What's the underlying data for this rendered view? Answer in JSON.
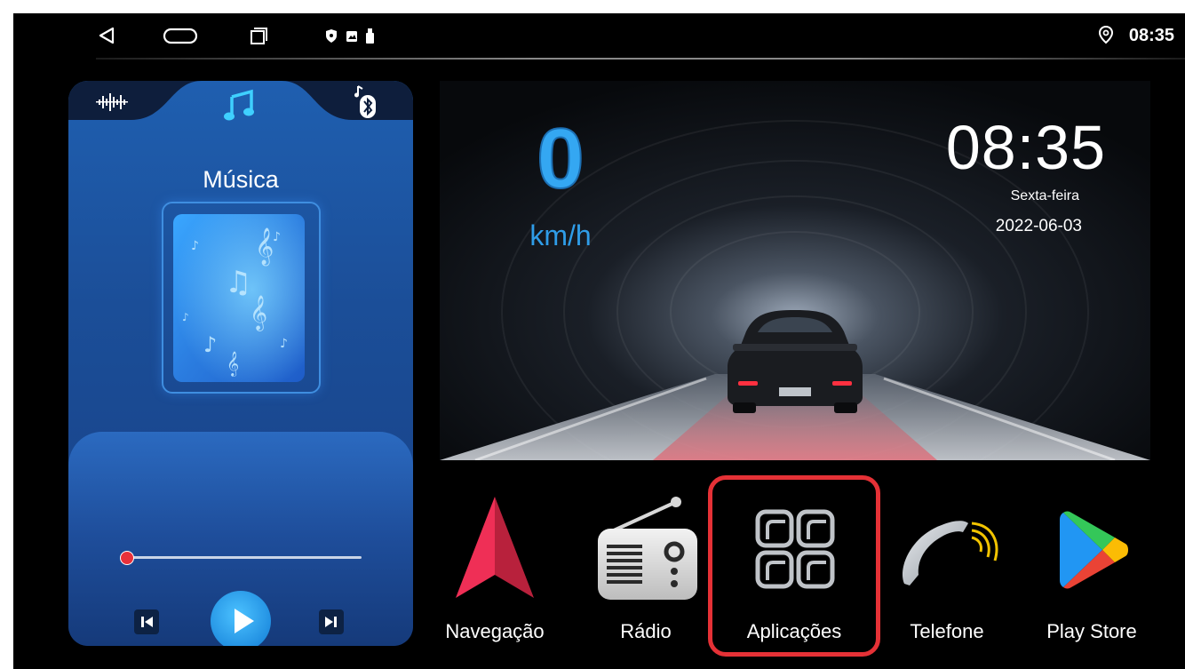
{
  "status_bar": {
    "time": "08:35",
    "icons": [
      "back-icon",
      "home-icon",
      "recents-icon",
      "shield-icon",
      "image-icon",
      "usb-icon",
      "location-icon"
    ]
  },
  "music_widget": {
    "tabs": [
      "equalizer-icon",
      "music-note-icon",
      "bluetooth-music-icon"
    ],
    "title": "Música",
    "progress": 0.0,
    "accent": "#e8313b"
  },
  "dashboard": {
    "speed": "0",
    "unit": "km/h",
    "time": "08:35",
    "day": "Sexta-feira",
    "date": "2022-06-03",
    "speed_color": "#34a7f2"
  },
  "apps": [
    {
      "label": "Navegação",
      "icon": "navigation-arrow-icon"
    },
    {
      "label": "Rádio",
      "icon": "radio-icon"
    },
    {
      "label": "Aplicações",
      "icon": "apps-grid-icon",
      "highlighted": true
    },
    {
      "label": "Telefone",
      "icon": "phone-handset-icon"
    },
    {
      "label": "Play Store",
      "icon": "play-store-icon"
    }
  ],
  "highlight_color": "#e53136"
}
